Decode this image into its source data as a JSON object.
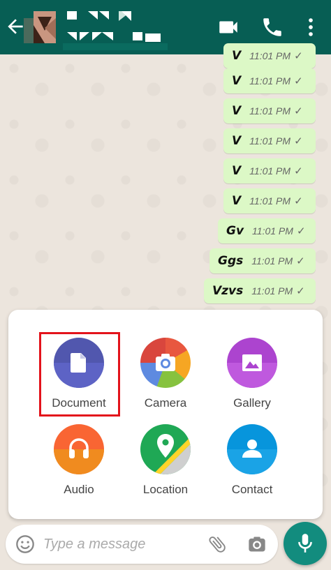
{
  "header": {
    "back_icon": "arrow-left-icon",
    "icons": [
      "video-call-icon",
      "phone-icon",
      "more-vert-icon"
    ]
  },
  "messages": [
    {
      "text": "V",
      "time": "11:01 PM",
      "status": "✓"
    },
    {
      "text": "V",
      "time": "11:01 PM",
      "status": "✓"
    },
    {
      "text": "V",
      "time": "11:01 PM",
      "status": "✓"
    },
    {
      "text": "V",
      "time": "11:01 PM",
      "status": "✓"
    },
    {
      "text": "V",
      "time": "11:01 PM",
      "status": "✓"
    },
    {
      "text": "V",
      "time": "11:01 PM",
      "status": "✓"
    },
    {
      "text": "Gv",
      "time": "11:01 PM",
      "status": "✓"
    },
    {
      "text": "Ggs",
      "time": "11:01 PM",
      "status": "✓"
    },
    {
      "text": "Vzvs",
      "time": "11:01 PM",
      "status": "✓"
    }
  ],
  "attachments": [
    {
      "label": "Document",
      "icon": "document-icon",
      "color": "#5157ae"
    },
    {
      "label": "Camera",
      "icon": "camera-icon",
      "color": "#e8573f"
    },
    {
      "label": "Gallery",
      "icon": "gallery-icon",
      "color": "#ac44cf"
    },
    {
      "label": "Audio",
      "icon": "headphones-icon",
      "color": "#f96533"
    },
    {
      "label": "Location",
      "icon": "location-icon",
      "color": "#1fa855"
    },
    {
      "label": "Contact",
      "icon": "contact-icon",
      "color": "#0795dc"
    }
  ],
  "composer": {
    "placeholder": "Type a message",
    "icons": [
      "emoji-icon",
      "attach-icon",
      "camera-icon",
      "mic-icon"
    ]
  }
}
